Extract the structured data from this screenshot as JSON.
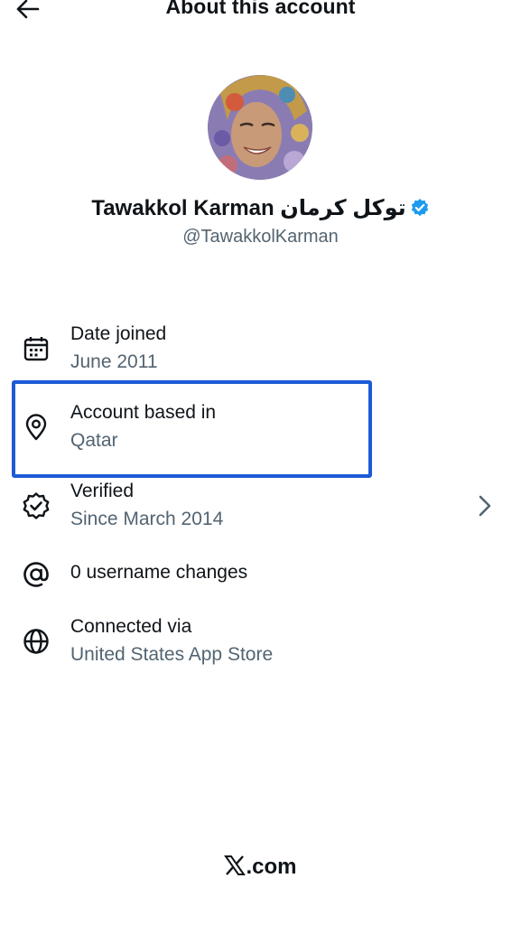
{
  "header": {
    "title": "About this account",
    "back_icon": "arrow-left-icon"
  },
  "profile": {
    "name": "Tawakkol Karman توكل كرمان",
    "handle": "@TawakkolKarman",
    "verified_icon": "verified-badge-icon",
    "verified_color": "#1d9bf0"
  },
  "details": {
    "date_joined": {
      "label": "Date joined",
      "value": "June 2011",
      "icon": "calendar-icon"
    },
    "account_based_in": {
      "label": "Account based in",
      "value": "Qatar",
      "icon": "location-pin-icon"
    },
    "verified": {
      "label": "Verified",
      "value": "Since March 2014",
      "icon": "verified-check-icon",
      "chevron_icon": "chevron-right-icon"
    },
    "username_changes": {
      "label": "0 username changes",
      "icon": "at-sign-icon"
    },
    "connected_via": {
      "label": "Connected via",
      "value": "United States App Store",
      "icon": "globe-icon"
    }
  },
  "highlight_color": "#1d5bd6",
  "footer": {
    "text": ".com",
    "logo": "x-logo-icon"
  }
}
